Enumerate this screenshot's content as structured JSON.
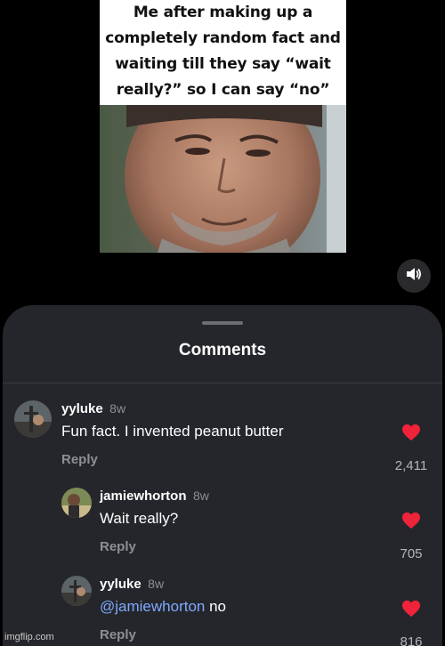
{
  "meme": {
    "caption_lines": [
      "Me after making up a",
      "completely random fact and",
      "waiting till they say “wait",
      "really?” so I can say “no”"
    ]
  },
  "controls": {
    "mute_icon": "speaker-icon"
  },
  "comments_sheet": {
    "title": "Comments",
    "items": [
      {
        "username": "yyluke",
        "time": "8w",
        "text": "Fun fact. I invented peanut butter",
        "reply_label": "Reply",
        "likes": "2,411"
      },
      {
        "username": "jamiewhorton",
        "time": "8w",
        "text": "Wait really?",
        "reply_label": "Reply",
        "likes": "705"
      },
      {
        "username": "yyluke",
        "time": "8w",
        "mention": "@jamiewhorton",
        "text": " no",
        "reply_label": "Reply",
        "likes": "816"
      }
    ]
  },
  "watermark": "imgflip.com",
  "colors": {
    "like_red": "#f0233b",
    "sheet_bg": "#25262b",
    "mention_blue": "#7ea8ff"
  }
}
